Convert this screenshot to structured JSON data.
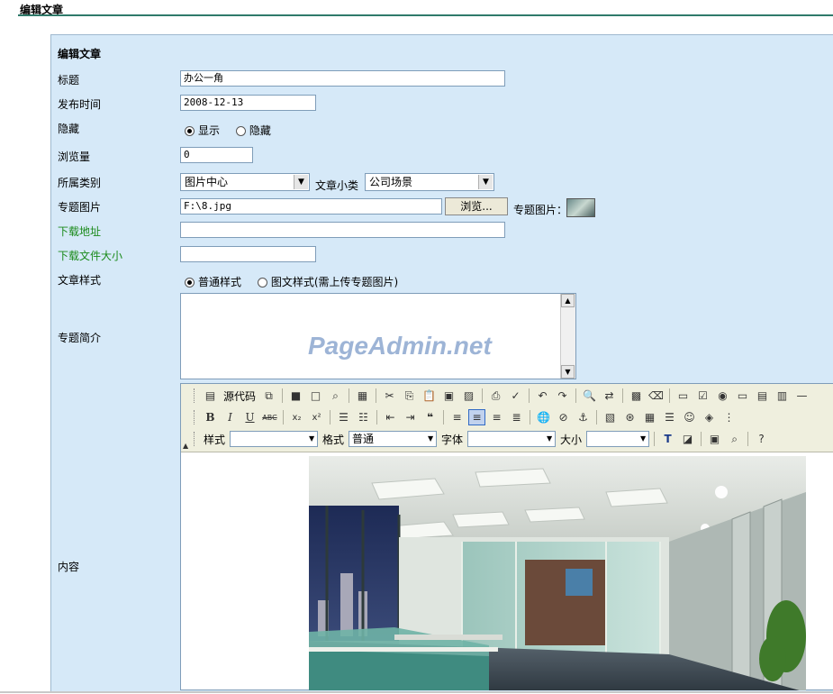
{
  "page": {
    "heading": "编辑文章"
  },
  "form": {
    "panel_title": "编辑文章",
    "title": {
      "label": "标题",
      "value": "办公一角"
    },
    "publish_time": {
      "label": "发布时间",
      "value": "2008-12-13"
    },
    "hidden": {
      "label": "隐藏",
      "options": [
        "显示",
        "隐藏"
      ],
      "selected": "显示"
    },
    "views": {
      "label": "浏览量",
      "value": "0"
    },
    "category": {
      "label": "所属类别",
      "value": "图片中心",
      "sub_label": "文章小类",
      "sub_value": "公司场景"
    },
    "topic_image": {
      "label": "专题图片",
      "value": "F:\\8.jpg",
      "browse_label": "浏览...",
      "preview_label": "专题图片："
    },
    "download_url": {
      "label": "下载地址",
      "value": ""
    },
    "download_size": {
      "label": "下载文件大小",
      "value": ""
    },
    "article_style": {
      "label": "文章样式",
      "options": [
        "普通样式",
        "图文样式(需上传专题图片)"
      ],
      "selected": "普通样式"
    },
    "summary": {
      "label": "专题简介",
      "watermark": "PageAdmin.net"
    },
    "content": {
      "label": "内容"
    }
  },
  "editor": {
    "source_label": "源代码",
    "style_label": "样式",
    "style_value": "",
    "format_label": "格式",
    "format_value": "普通",
    "font_label": "字体",
    "font_value": "",
    "size_label": "大小",
    "size_value": "",
    "bold": "B",
    "italic": "I",
    "underline": "U",
    "strike": "ABC"
  },
  "colors": {
    "panel": "#d6e9f8",
    "green_label": "#1a8a1a",
    "rule": "#2f7a6a"
  }
}
